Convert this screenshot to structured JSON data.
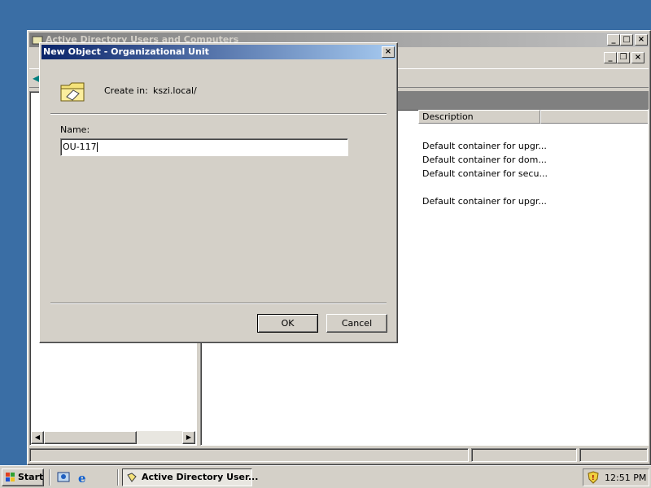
{
  "main_window": {
    "title": "Active Directory Users and Computers",
    "columns": {
      "description": "Description"
    },
    "rows": [
      {
        "description": "Default container for upgr..."
      },
      {
        "description": "Default container for dom..."
      },
      {
        "description": "Default container for secu..."
      },
      {
        "description": ""
      },
      {
        "description": "Default container for upgr..."
      }
    ]
  },
  "dialog": {
    "title": "New Object - Organizational Unit",
    "create_in_label": "Create in:",
    "create_in_value": "kszi.local/",
    "name_label": "Name:",
    "name_value": "OU-117",
    "ok_label": "OK",
    "cancel_label": "Cancel"
  },
  "taskbar": {
    "start_label": "Start",
    "task_label": "Active Directory User...",
    "clock": "12:51 PM"
  },
  "colors": {
    "desktop": "#3a6ea5",
    "titlebar_active": "#0a246a",
    "titlebar_inactive": "#808080",
    "face": "#d4d0c8"
  }
}
